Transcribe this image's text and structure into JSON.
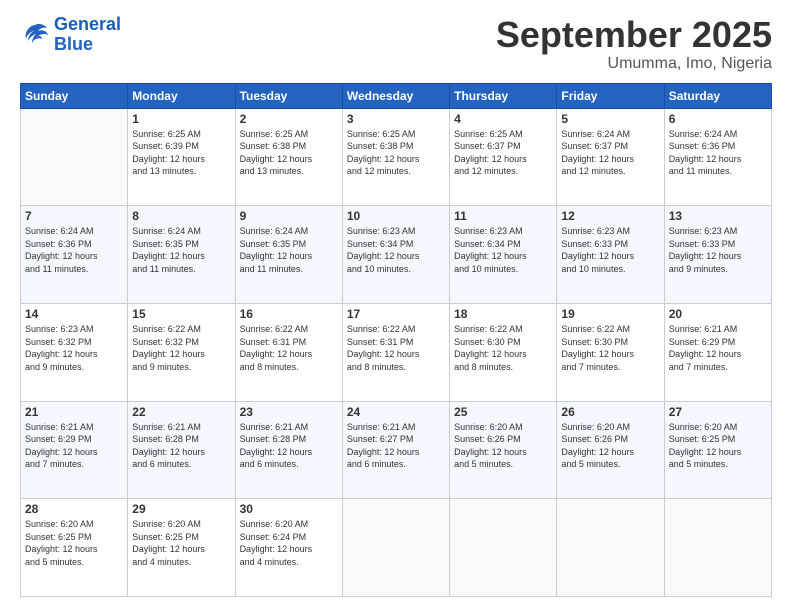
{
  "logo": {
    "line1": "General",
    "line2": "Blue"
  },
  "title": "September 2025",
  "subtitle": "Umumma, Imo, Nigeria",
  "weekdays": [
    "Sunday",
    "Monday",
    "Tuesday",
    "Wednesday",
    "Thursday",
    "Friday",
    "Saturday"
  ],
  "weeks": [
    [
      {
        "num": "",
        "detail": ""
      },
      {
        "num": "1",
        "detail": "Sunrise: 6:25 AM\nSunset: 6:39 PM\nDaylight: 12 hours\nand 13 minutes."
      },
      {
        "num": "2",
        "detail": "Sunrise: 6:25 AM\nSunset: 6:38 PM\nDaylight: 12 hours\nand 13 minutes."
      },
      {
        "num": "3",
        "detail": "Sunrise: 6:25 AM\nSunset: 6:38 PM\nDaylight: 12 hours\nand 12 minutes."
      },
      {
        "num": "4",
        "detail": "Sunrise: 6:25 AM\nSunset: 6:37 PM\nDaylight: 12 hours\nand 12 minutes."
      },
      {
        "num": "5",
        "detail": "Sunrise: 6:24 AM\nSunset: 6:37 PM\nDaylight: 12 hours\nand 12 minutes."
      },
      {
        "num": "6",
        "detail": "Sunrise: 6:24 AM\nSunset: 6:36 PM\nDaylight: 12 hours\nand 11 minutes."
      }
    ],
    [
      {
        "num": "7",
        "detail": "Sunrise: 6:24 AM\nSunset: 6:36 PM\nDaylight: 12 hours\nand 11 minutes."
      },
      {
        "num": "8",
        "detail": "Sunrise: 6:24 AM\nSunset: 6:35 PM\nDaylight: 12 hours\nand 11 minutes."
      },
      {
        "num": "9",
        "detail": "Sunrise: 6:24 AM\nSunset: 6:35 PM\nDaylight: 12 hours\nand 11 minutes."
      },
      {
        "num": "10",
        "detail": "Sunrise: 6:23 AM\nSunset: 6:34 PM\nDaylight: 12 hours\nand 10 minutes."
      },
      {
        "num": "11",
        "detail": "Sunrise: 6:23 AM\nSunset: 6:34 PM\nDaylight: 12 hours\nand 10 minutes."
      },
      {
        "num": "12",
        "detail": "Sunrise: 6:23 AM\nSunset: 6:33 PM\nDaylight: 12 hours\nand 10 minutes."
      },
      {
        "num": "13",
        "detail": "Sunrise: 6:23 AM\nSunset: 6:33 PM\nDaylight: 12 hours\nand 9 minutes."
      }
    ],
    [
      {
        "num": "14",
        "detail": "Sunrise: 6:23 AM\nSunset: 6:32 PM\nDaylight: 12 hours\nand 9 minutes."
      },
      {
        "num": "15",
        "detail": "Sunrise: 6:22 AM\nSunset: 6:32 PM\nDaylight: 12 hours\nand 9 minutes."
      },
      {
        "num": "16",
        "detail": "Sunrise: 6:22 AM\nSunset: 6:31 PM\nDaylight: 12 hours\nand 8 minutes."
      },
      {
        "num": "17",
        "detail": "Sunrise: 6:22 AM\nSunset: 6:31 PM\nDaylight: 12 hours\nand 8 minutes."
      },
      {
        "num": "18",
        "detail": "Sunrise: 6:22 AM\nSunset: 6:30 PM\nDaylight: 12 hours\nand 8 minutes."
      },
      {
        "num": "19",
        "detail": "Sunrise: 6:22 AM\nSunset: 6:30 PM\nDaylight: 12 hours\nand 7 minutes."
      },
      {
        "num": "20",
        "detail": "Sunrise: 6:21 AM\nSunset: 6:29 PM\nDaylight: 12 hours\nand 7 minutes."
      }
    ],
    [
      {
        "num": "21",
        "detail": "Sunrise: 6:21 AM\nSunset: 6:29 PM\nDaylight: 12 hours\nand 7 minutes."
      },
      {
        "num": "22",
        "detail": "Sunrise: 6:21 AM\nSunset: 6:28 PM\nDaylight: 12 hours\nand 6 minutes."
      },
      {
        "num": "23",
        "detail": "Sunrise: 6:21 AM\nSunset: 6:28 PM\nDaylight: 12 hours\nand 6 minutes."
      },
      {
        "num": "24",
        "detail": "Sunrise: 6:21 AM\nSunset: 6:27 PM\nDaylight: 12 hours\nand 6 minutes."
      },
      {
        "num": "25",
        "detail": "Sunrise: 6:20 AM\nSunset: 6:26 PM\nDaylight: 12 hours\nand 5 minutes."
      },
      {
        "num": "26",
        "detail": "Sunrise: 6:20 AM\nSunset: 6:26 PM\nDaylight: 12 hours\nand 5 minutes."
      },
      {
        "num": "27",
        "detail": "Sunrise: 6:20 AM\nSunset: 6:25 PM\nDaylight: 12 hours\nand 5 minutes."
      }
    ],
    [
      {
        "num": "28",
        "detail": "Sunrise: 6:20 AM\nSunset: 6:25 PM\nDaylight: 12 hours\nand 5 minutes."
      },
      {
        "num": "29",
        "detail": "Sunrise: 6:20 AM\nSunset: 6:25 PM\nDaylight: 12 hours\nand 4 minutes."
      },
      {
        "num": "30",
        "detail": "Sunrise: 6:20 AM\nSunset: 6:24 PM\nDaylight: 12 hours\nand 4 minutes."
      },
      {
        "num": "",
        "detail": ""
      },
      {
        "num": "",
        "detail": ""
      },
      {
        "num": "",
        "detail": ""
      },
      {
        "num": "",
        "detail": ""
      }
    ]
  ]
}
